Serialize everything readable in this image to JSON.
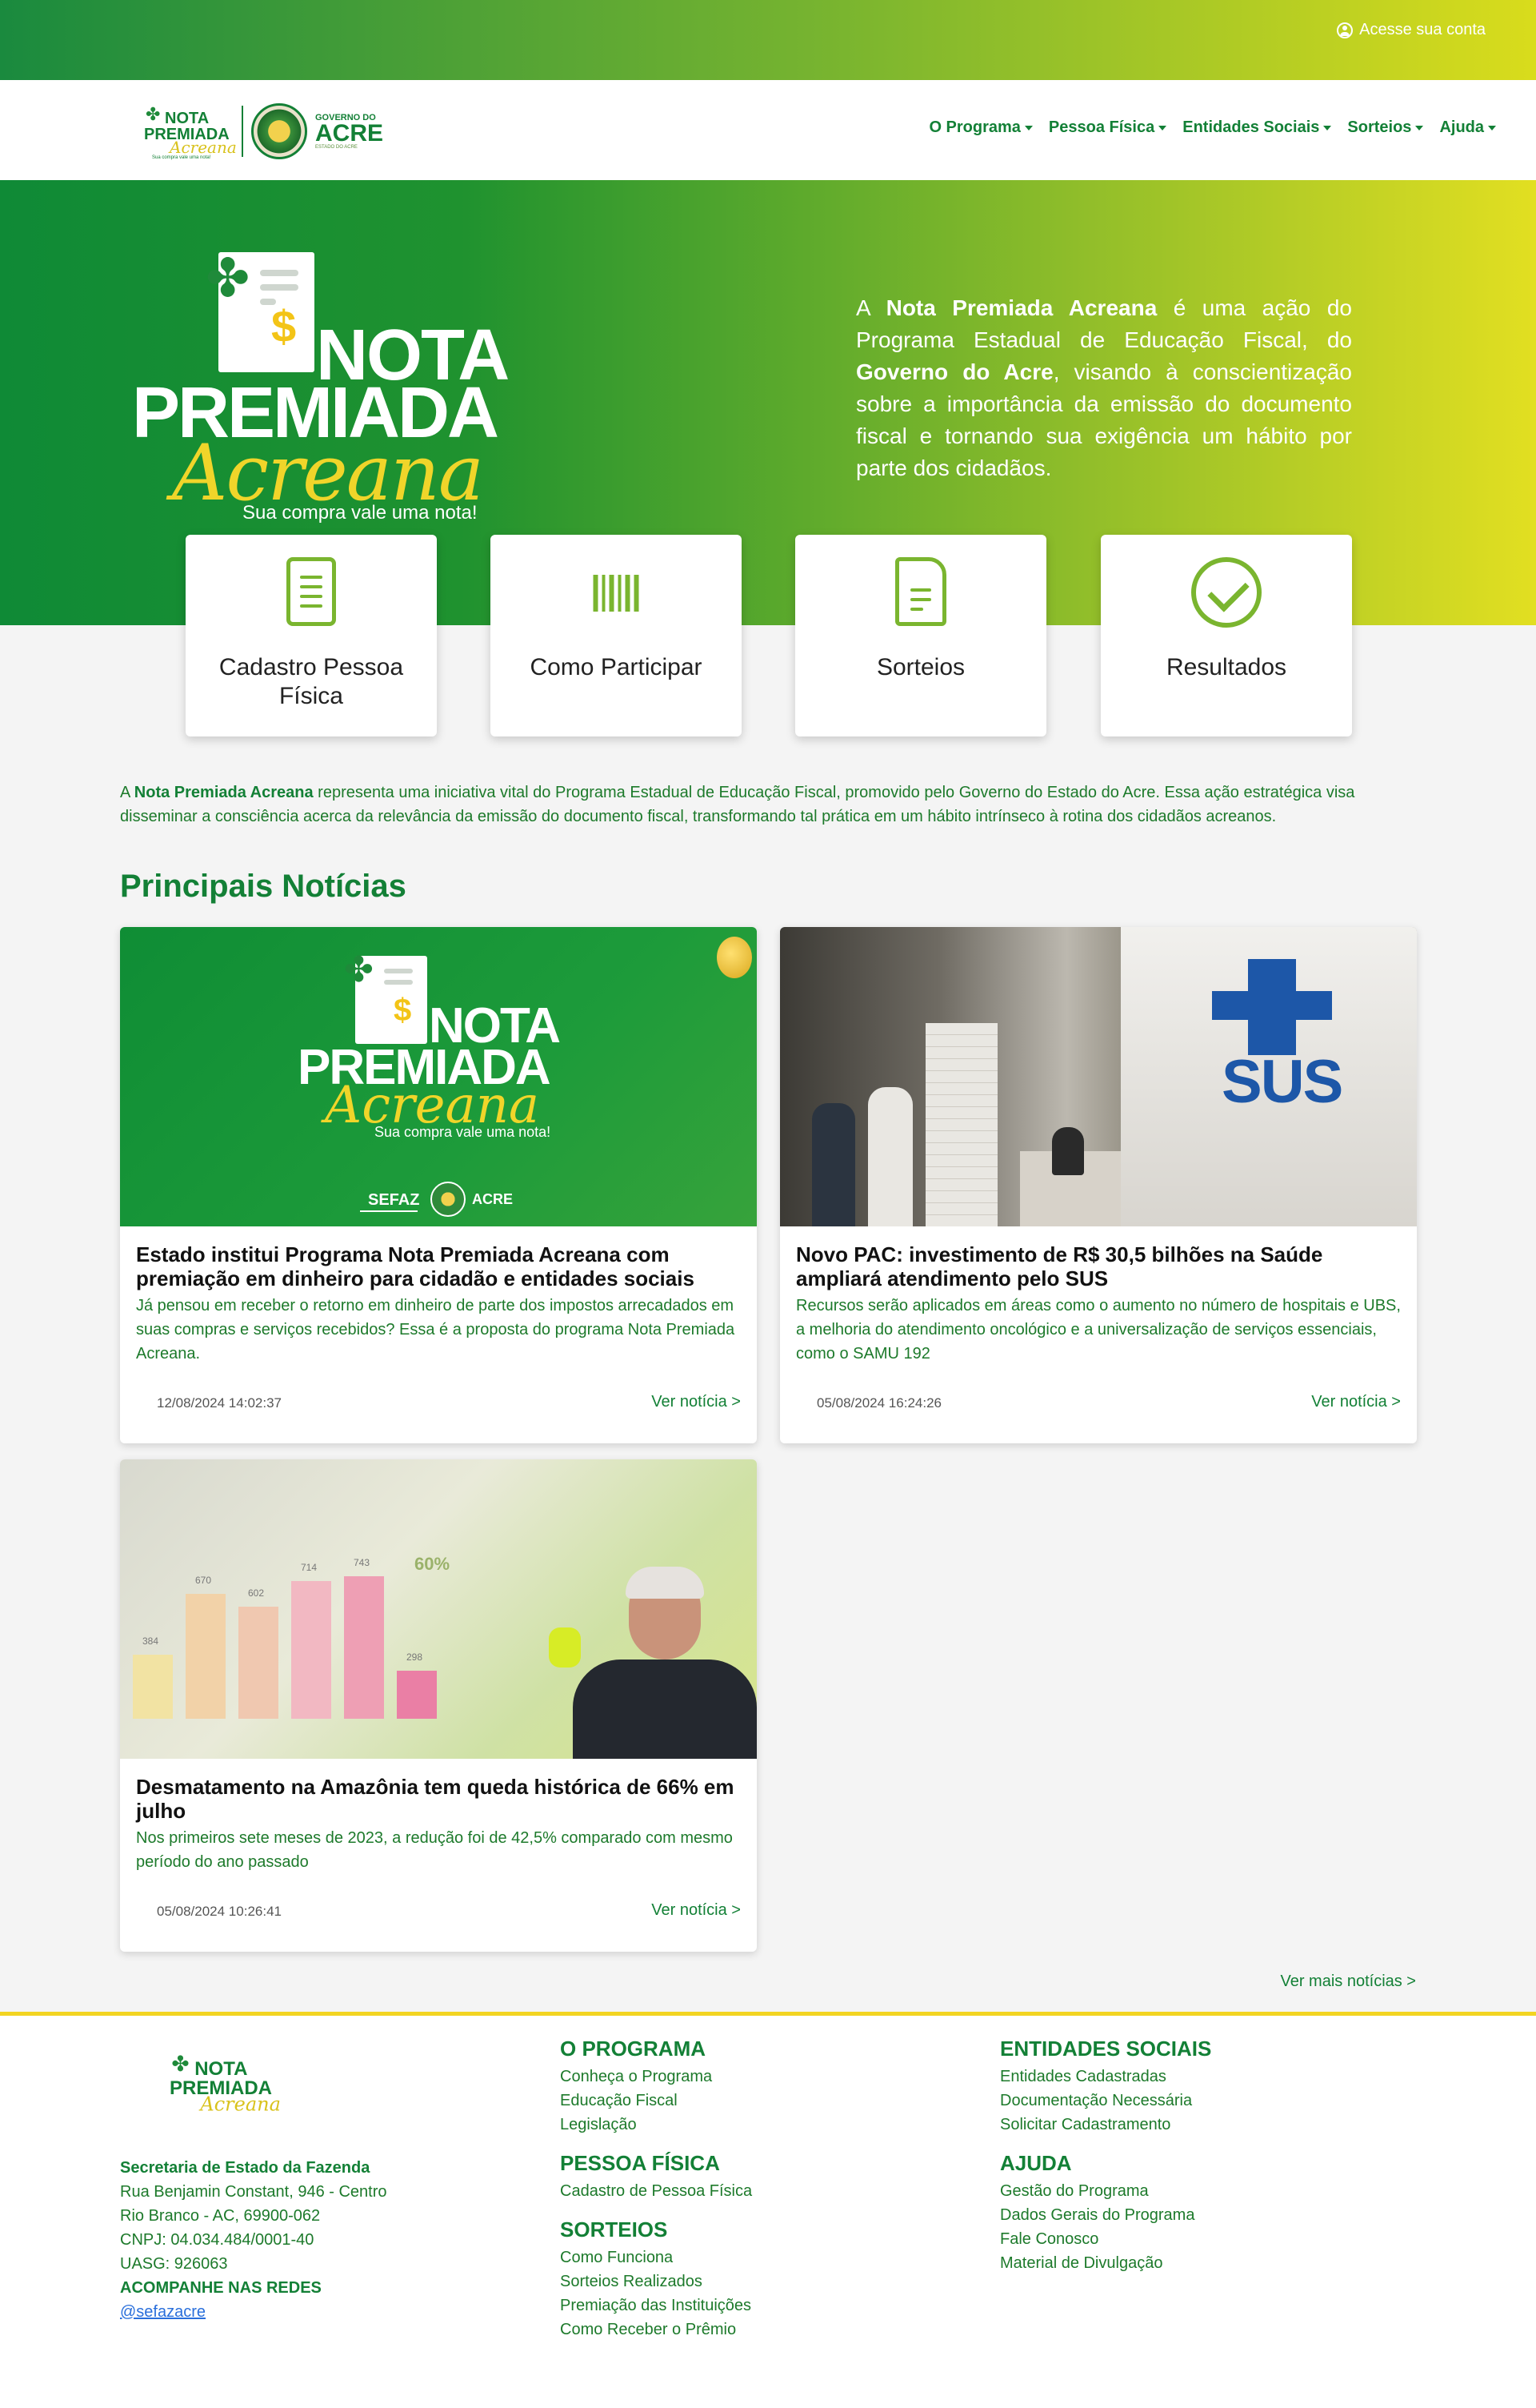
{
  "topbar": {
    "account_label": "Acesse sua conta"
  },
  "nav": {
    "logo": {
      "w1": "NOTA",
      "w2": "PREMIADA",
      "w3": "Acreana",
      "w4": "Sua compra vale uma nota!"
    },
    "gov": {
      "g1": "GOVERNO DO",
      "g2": "ACRE",
      "g3": "ESTADO DO ACRE"
    },
    "items": [
      "O Programa",
      "Pessoa Física",
      "Entidades Sociais",
      "Sorteios",
      "Ajuda"
    ]
  },
  "hero": {
    "logo": {
      "nota": "NOTA",
      "premiada": "PREMIADA",
      "acreana": "Acreana",
      "tagline": "Sua compra vale uma nota!"
    },
    "text": {
      "t1": "A ",
      "b1": "Nota Premiada Acreana",
      "t2": " é uma ação do Programa Estadual de Educação Fiscal, do ",
      "b2": "Governo do Acre",
      "t3": ", visando à conscientização sobre a importância da emissão do documento fiscal e tornando sua exigência um hábito por parte dos cidadãos."
    }
  },
  "actions": [
    {
      "label": "Cadastro Pessoa Física",
      "icon": "document-icon"
    },
    {
      "label": "Como Participar",
      "icon": "barcode-icon"
    },
    {
      "label": "Sorteios",
      "icon": "file-icon"
    },
    {
      "label": "Resultados",
      "icon": "check-circle-icon"
    }
  ],
  "intro": {
    "bold": "Nota Premiada Acreana",
    "pre": "A ",
    "text": " representa uma iniciativa vital do Programa Estadual de Educação Fiscal, promovido pelo Governo do Estado do Acre. Essa ação estratégica visa disseminar a consciência acerca da relevância da emissão do documento fiscal, transformando tal prática em um hábito intrínseco à rotina dos cidadãos acreanos."
  },
  "news_section": {
    "title": "Principais Notícias",
    "see_more": "Ver mais notícias >"
  },
  "news": [
    {
      "title": "Estado institui Programa Nota Premiada Acreana com premiação em dinheiro para cidadão e entidades sociais",
      "desc": "Já pensou em receber o retorno em dinheiro de parte dos impostos arrecadados em suas compras e serviços recebidos? Essa é a proposta do programa Nota Premiada Acreana.",
      "date": "12/08/2024 14:02:37",
      "more": "Ver notícia >",
      "img": {
        "nota": "NOTA",
        "premiada": "PREMIADA",
        "acreana": "Acreana",
        "tagline": "Sua compra vale uma nota!",
        "sefaz": "SEFAZ",
        "acre": "ACRE"
      }
    },
    {
      "title": "Novo PAC: investimento de R$ 30,5 bilhões na Saúde ampliará atendimento pelo SUS",
      "desc": "Recursos serão aplicados em áreas como o aumento no número de hospitais e UBS, a melhoria do atendimento oncológico e a universalização de serviços essenciais, como o SAMU 192",
      "date": "05/08/2024 16:24:26",
      "more": "Ver notícia >",
      "img": {
        "sus": "SUS"
      }
    },
    {
      "title": "Desmatamento na Amazônia tem queda histórica de 66% em julho",
      "desc": "Nos primeiros sete meses de 2023, a redução foi de 42,5% comparado com mesmo período do ano passado",
      "date": "05/08/2024 10:26:41",
      "more": "Ver notícia >",
      "img": {
        "values": [
          "384",
          "670",
          "602",
          "714",
          "743",
          "298"
        ],
        "pct": "60%"
      }
    }
  ],
  "footer": {
    "address": {
      "org": "Secretaria de Estado da Fazenda",
      "street": "Rua Benjamin Constant, 946 - Centro",
      "city": "Rio Branco - AC, 69900-062",
      "cnpj": "CNPJ: 04.034.484/0001-40",
      "uasg": "UASG: 926063",
      "follow": "ACOMPANHE NAS REDES",
      "handle": "@sefazacre"
    },
    "col1": [
      {
        "head": "O PROGRAMA",
        "links": [
          "Conheça o Programa",
          "Educação Fiscal",
          "Legislação"
        ]
      },
      {
        "head": "PESSOA FÍSICA",
        "links": [
          "Cadastro de Pessoa Física"
        ]
      },
      {
        "head": "SORTEIOS",
        "links": [
          "Como Funciona",
          "Sorteios Realizados",
          "Premiação das Instituições",
          "Como Receber o Prêmio"
        ]
      }
    ],
    "col2": [
      {
        "head": "ENTIDADES SOCIAIS",
        "links": [
          "Entidades Cadastradas",
          "Documentação Necessária",
          "Solicitar Cadastramento"
        ]
      },
      {
        "head": "AJUDA",
        "links": [
          "Gestão do Programa",
          "Dados Gerais do Programa",
          "Fale Conosco",
          "Material de Divulgação"
        ]
      }
    ]
  }
}
